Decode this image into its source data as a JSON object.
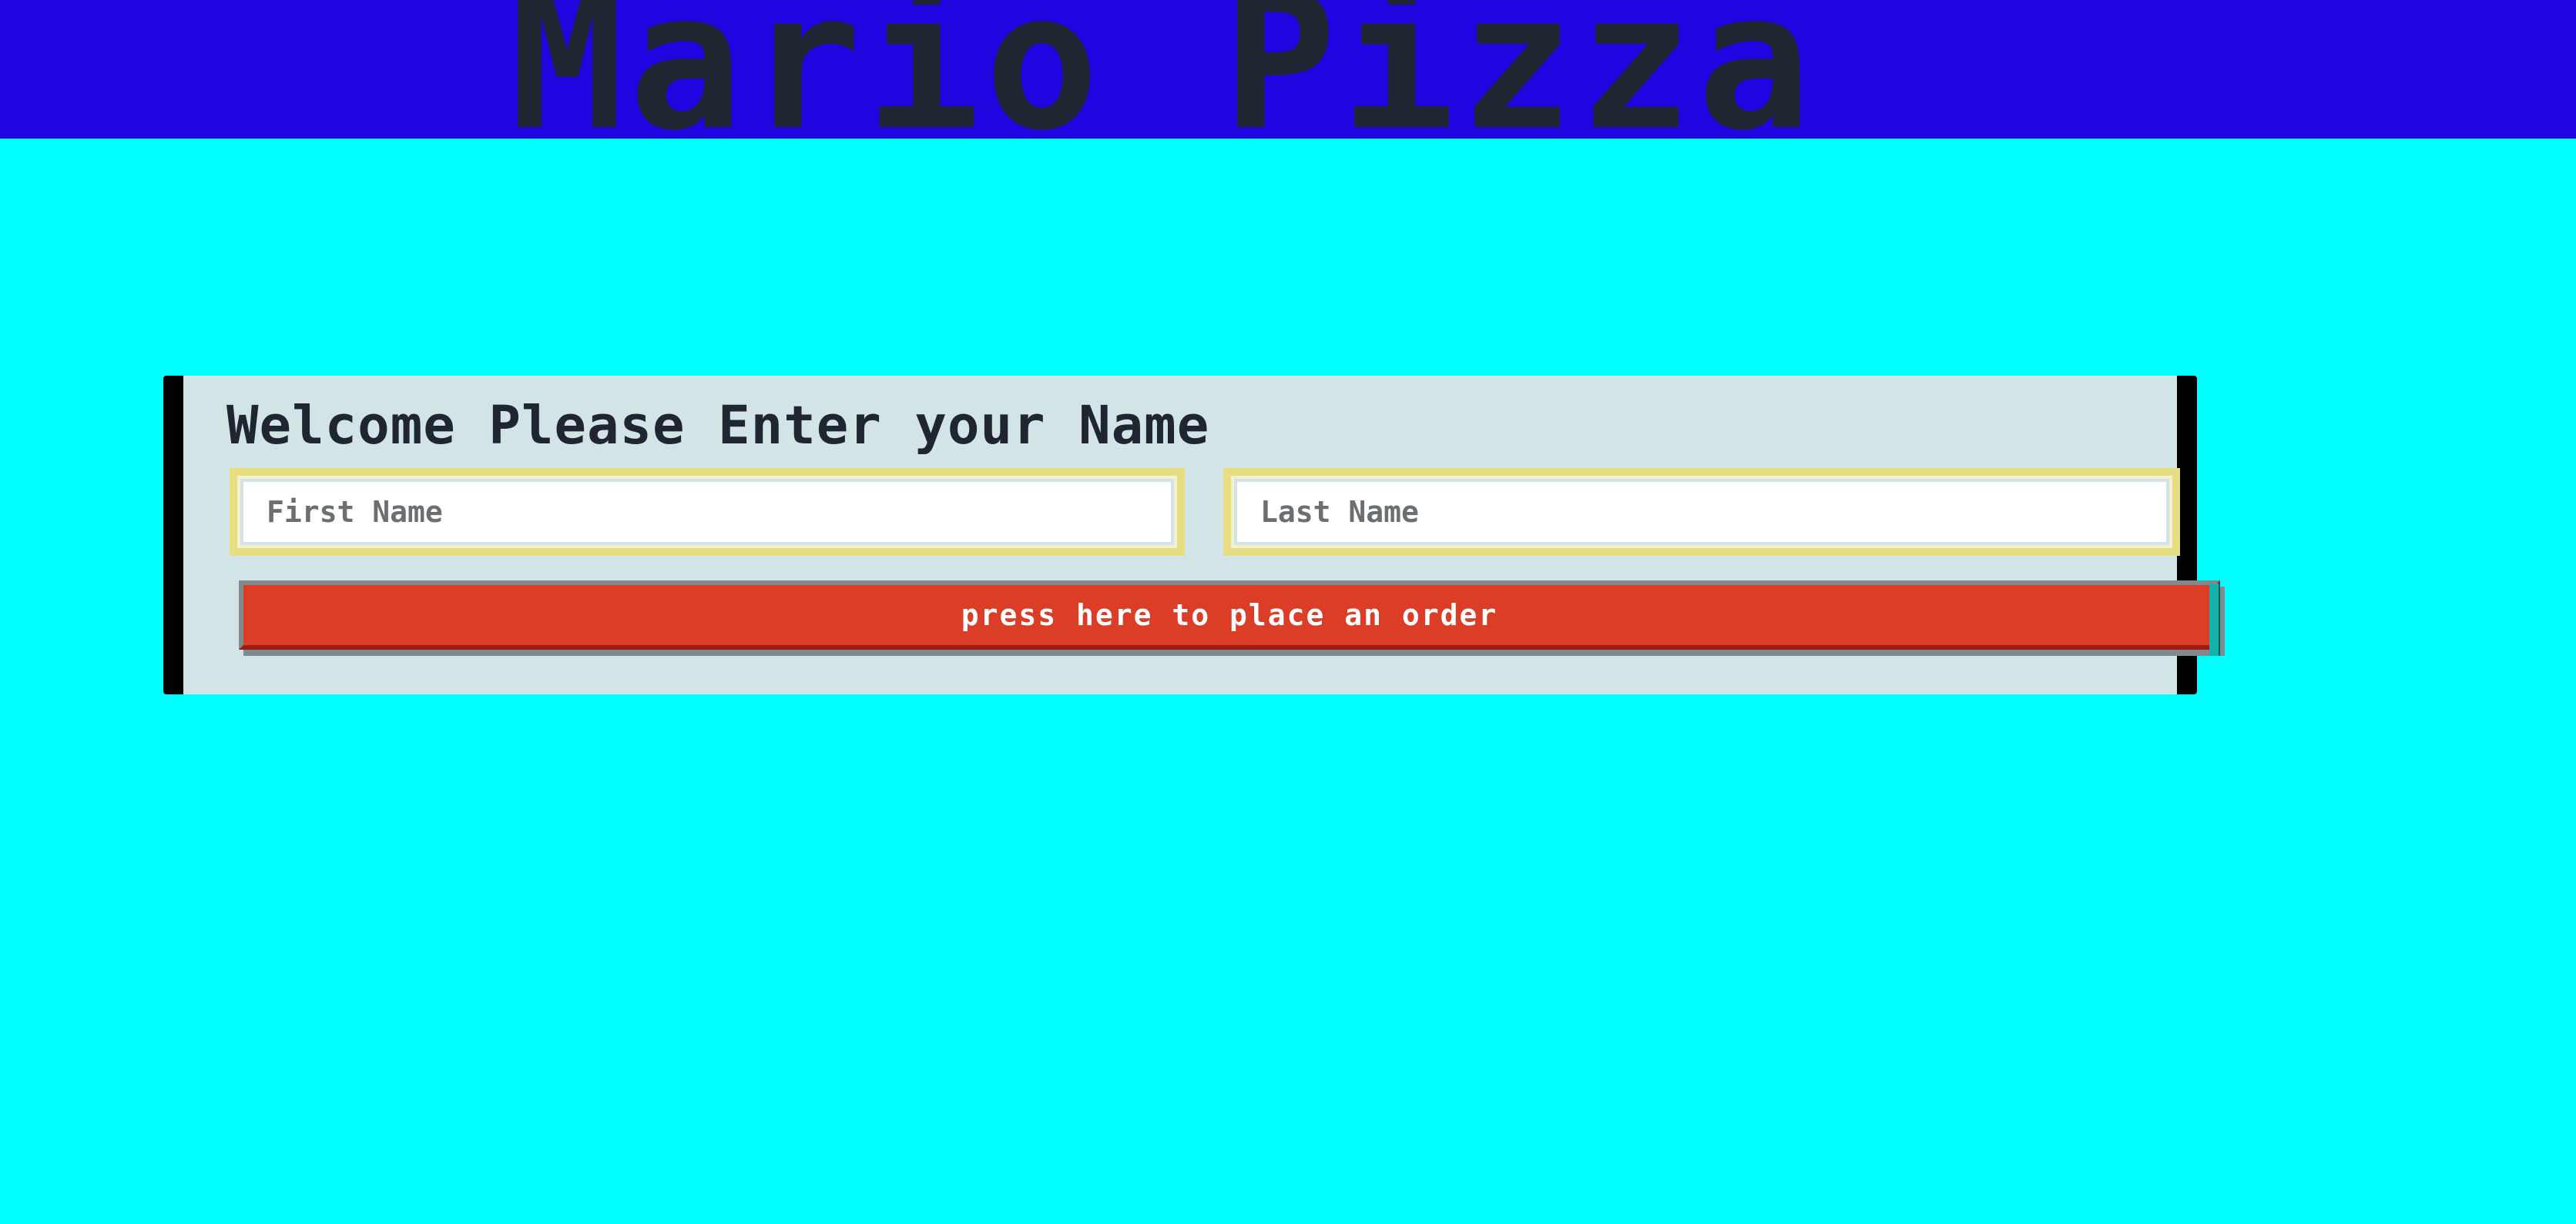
{
  "header": {
    "title": "Mario Pizza"
  },
  "form": {
    "heading": "Welcome Please Enter your Name",
    "first_name": {
      "value": "",
      "placeholder": "First Name"
    },
    "last_name": {
      "value": "",
      "placeholder": "Last Name"
    },
    "submit_label": "press here to place an order"
  },
  "colors": {
    "header_background": "#1f05df",
    "page_background": "#00ffff",
    "card_background": "#d3e4e6",
    "card_border": "#000000",
    "input_border": "#e7de84",
    "button_background": "#dc3d27",
    "text_dark": "#202631",
    "button_text": "#ffffff"
  }
}
